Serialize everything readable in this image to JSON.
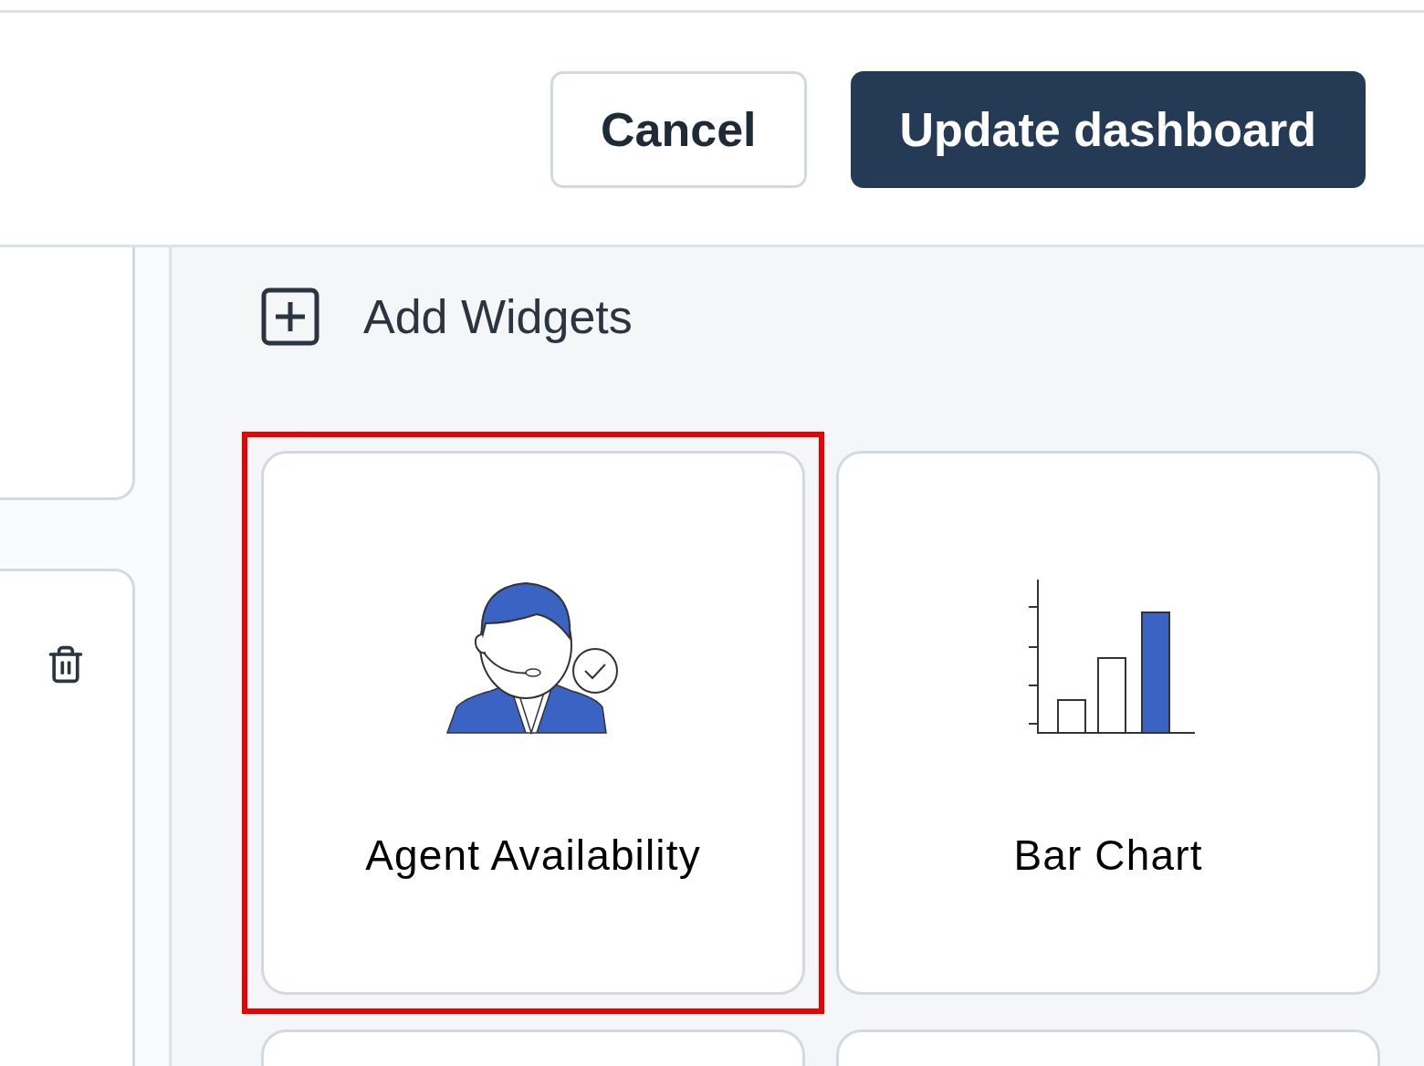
{
  "header": {
    "buttons": [
      {
        "label": "Cancel",
        "kind": "secondary"
      },
      {
        "label": "Update dashboard",
        "kind": "primary"
      }
    ]
  },
  "dashboard_cards": [
    {
      "kind": "plain"
    },
    {
      "kind": "deletable"
    }
  ],
  "widget_panel": {
    "title": "Add Widgets",
    "widgets": [
      {
        "label": "Agent Availability",
        "kind": "agent",
        "selected": true
      },
      {
        "label": "Bar Chart",
        "kind": "bar_chart",
        "selected": false
      },
      {
        "kind": "hidden",
        "selected": false
      },
      {
        "kind": "hidden",
        "selected": false
      }
    ]
  }
}
